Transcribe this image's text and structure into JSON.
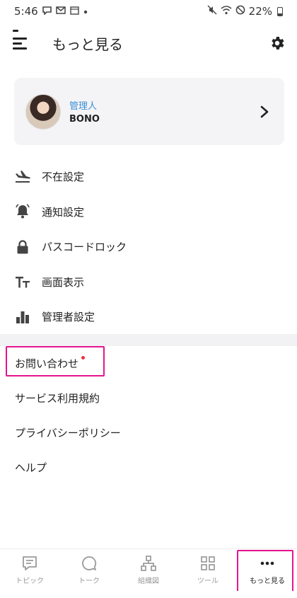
{
  "status_bar": {
    "time": "5:46",
    "left_icons": [
      "chat-icon",
      "mail-icon",
      "calendar-icon",
      "dot-icon"
    ],
    "right_icons": [
      "mute-icon",
      "wifi-icon",
      "dnd-icon"
    ],
    "battery_text": "22%",
    "battery_level": 0.22
  },
  "header": {
    "title": "もっと見る",
    "has_notification": true
  },
  "profile": {
    "role": "管理人",
    "name": "BONO"
  },
  "menu": {
    "items": [
      {
        "label": "不在設定",
        "icon": "airplane-landing-icon"
      },
      {
        "label": "通知設定",
        "icon": "bell-icon"
      },
      {
        "label": "パスコードロック",
        "icon": "lock-icon"
      },
      {
        "label": "画面表示",
        "icon": "text-size-icon"
      },
      {
        "label": "管理者設定",
        "icon": "bar-chart-icon"
      }
    ]
  },
  "support": {
    "items": [
      {
        "label": "お問い合わせ",
        "has_dot": true
      },
      {
        "label": "サービス利用規約"
      },
      {
        "label": "プライバシーポリシー"
      },
      {
        "label": "ヘルプ"
      }
    ]
  },
  "tabs": [
    {
      "label": "トピック",
      "icon": "topic-icon",
      "active": false
    },
    {
      "label": "トーク",
      "icon": "chat-bubble-icon",
      "active": false
    },
    {
      "label": "組織図",
      "icon": "org-chart-icon",
      "active": false
    },
    {
      "label": "ツール",
      "icon": "grid-icon",
      "active": false
    },
    {
      "label": "もっと見る",
      "icon": "more-dots-icon",
      "active": true
    }
  ],
  "colors": {
    "accent_red": "#f0522d",
    "role_blue": "#3b8fd6",
    "highlight_magenta": "#e6138f"
  }
}
